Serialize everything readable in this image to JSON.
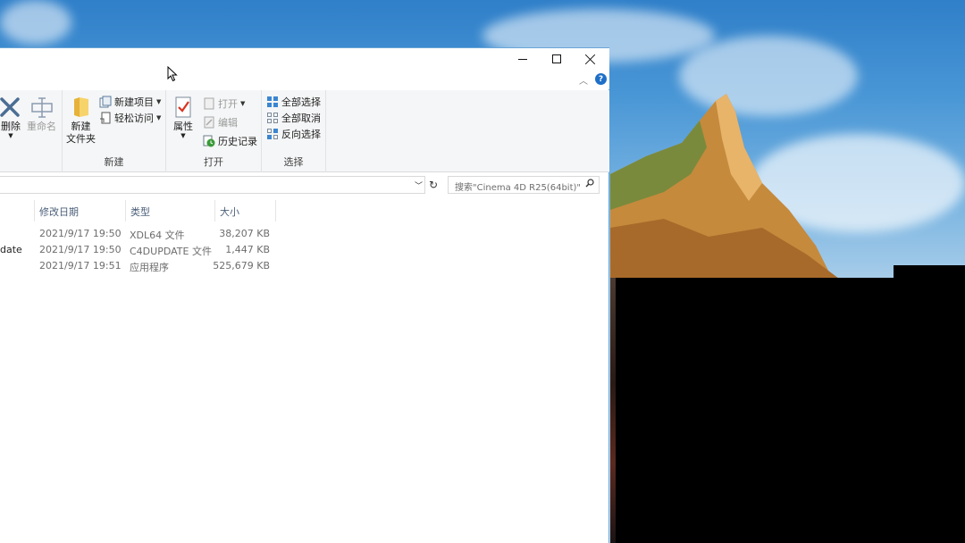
{
  "window": {
    "controls": {
      "minimize": "minimize",
      "maximize": "maximize",
      "close": "close"
    }
  },
  "ribbon": {
    "organize": {
      "delete_label": "删除",
      "rename_label": "重命名"
    },
    "new": {
      "new_folder_label_1": "新建",
      "new_folder_label_2": "文件夹",
      "new_item_label": "新建项目",
      "easy_access_label": "轻松访问",
      "group_label": "新建"
    },
    "open": {
      "properties_label": "属性",
      "open_label": "打开",
      "edit_label": "编辑",
      "history_label": "历史记录",
      "group_label": "打开"
    },
    "select": {
      "select_all_label": "全部选择",
      "select_none_label": "全部取消",
      "invert_label": "反向选择",
      "group_label": "选择"
    }
  },
  "address": {
    "search_placeholder": "搜索\"Cinema 4D R25(64bit)\""
  },
  "columns": {
    "date": "修改日期",
    "type": "类型",
    "size": "大小"
  },
  "files": [
    {
      "name": "",
      "date": "2021/9/17 19:50",
      "type": "XDL64 文件",
      "size": "38,207 KB"
    },
    {
      "name": "date",
      "date": "2021/9/17 19:50",
      "type": "C4DUPDATE 文件",
      "size": "1,447 KB"
    },
    {
      "name": "",
      "date": "2021/9/17 19:51",
      "type": "应用程序",
      "size": "525,679 KB"
    }
  ],
  "colors": {
    "accent": "#1e6fc8",
    "ribbon_bg": "#f5f6f7",
    "header_text": "#4c607a"
  }
}
